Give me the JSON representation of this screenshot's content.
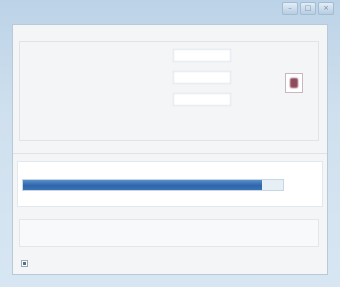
{
  "window": {
    "title": "",
    "minimize_glyph": "–",
    "maximize_glyph": "□",
    "close_glyph": "×",
    "icon": "app-icon"
  },
  "group": {
    "title": "",
    "rows": [
      {
        "label": "",
        "value": "",
        "unit": ""
      },
      {
        "label": "",
        "value": "",
        "unit": ""
      },
      {
        "label": "",
        "value": "",
        "unit": ""
      }
    ],
    "side_icon": "stop-icon"
  },
  "middle": {
    "line1": "",
    "line2": ""
  },
  "status": {
    "text": "",
    "progress_fraction": 0.92,
    "progress_color": "#2f66ab"
  },
  "log": {
    "label": "",
    "cells": [
      "",
      "",
      "",
      ""
    ]
  },
  "option": {
    "label": "",
    "checked": true
  }
}
